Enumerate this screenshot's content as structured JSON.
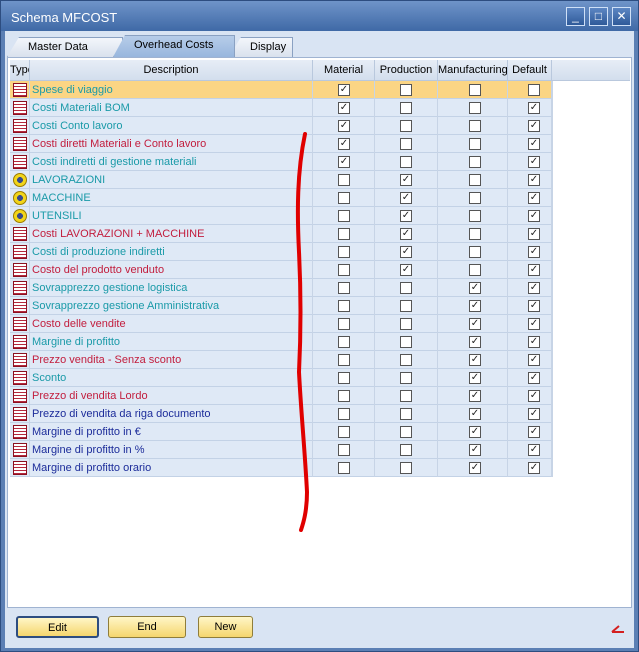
{
  "window": {
    "title": "Schema MFCOST"
  },
  "tabs": [
    {
      "label": "Master Data"
    },
    {
      "label": "Overhead Costs"
    },
    {
      "label": "Display"
    }
  ],
  "columns": {
    "type": "Type",
    "description": "Description",
    "material": "Material",
    "production": "Production",
    "manufacturing": "Manufacturing",
    "default": "Default"
  },
  "rows": [
    {
      "icon": "table-icon",
      "desc": "Spese di viaggio",
      "color": "teal",
      "material": true,
      "production": false,
      "manufacturing": false,
      "default": false,
      "selected": true
    },
    {
      "icon": "table-icon",
      "desc": "Costi Materiali BOM",
      "color": "teal",
      "material": true,
      "production": false,
      "manufacturing": false,
      "default": true
    },
    {
      "icon": "table-icon",
      "desc": "Costi Conto lavoro",
      "color": "teal",
      "material": true,
      "production": false,
      "manufacturing": false,
      "default": true
    },
    {
      "icon": "table-icon",
      "desc": "Costi diretti Materiali e Conto lavoro",
      "color": "red",
      "material": true,
      "production": false,
      "manufacturing": false,
      "default": true
    },
    {
      "icon": "table-icon",
      "desc": "Costi indiretti di gestione materiali",
      "color": "teal",
      "material": true,
      "production": false,
      "manufacturing": false,
      "default": true
    },
    {
      "icon": "gear-icon",
      "desc": "LAVORAZIONI",
      "color": "teal",
      "material": false,
      "production": true,
      "manufacturing": false,
      "default": true
    },
    {
      "icon": "gear-icon",
      "desc": "MACCHINE",
      "color": "teal",
      "material": false,
      "production": true,
      "manufacturing": false,
      "default": true
    },
    {
      "icon": "gear-icon",
      "desc": "UTENSILI",
      "color": "teal",
      "material": false,
      "production": true,
      "manufacturing": false,
      "default": true
    },
    {
      "icon": "table-icon",
      "desc": "Costi LAVORAZIONI + MACCHINE",
      "color": "red",
      "material": false,
      "production": true,
      "manufacturing": false,
      "default": true
    },
    {
      "icon": "table-icon",
      "desc": "Costi di produzione indiretti",
      "color": "teal",
      "material": false,
      "production": true,
      "manufacturing": false,
      "default": true
    },
    {
      "icon": "table-icon",
      "desc": "Costo del prodotto venduto",
      "color": "red",
      "material": false,
      "production": true,
      "manufacturing": false,
      "default": true
    },
    {
      "icon": "table-icon",
      "desc": "Sovrapprezzo gestione logistica",
      "color": "teal",
      "material": false,
      "production": false,
      "manufacturing": true,
      "default": true
    },
    {
      "icon": "table-icon",
      "desc": "Sovrapprezzo gestione Amministrativa",
      "color": "teal",
      "material": false,
      "production": false,
      "manufacturing": true,
      "default": true
    },
    {
      "icon": "table-icon",
      "desc": "Costo delle vendite",
      "color": "red",
      "material": false,
      "production": false,
      "manufacturing": true,
      "default": true
    },
    {
      "icon": "table-icon",
      "desc": "Margine di profitto",
      "color": "teal",
      "material": false,
      "production": false,
      "manufacturing": true,
      "default": true
    },
    {
      "icon": "table-icon",
      "desc": "Prezzo vendita - Senza sconto",
      "color": "red",
      "material": false,
      "production": false,
      "manufacturing": true,
      "default": true
    },
    {
      "icon": "table-icon",
      "desc": "Sconto",
      "color": "teal",
      "material": false,
      "production": false,
      "manufacturing": true,
      "default": true
    },
    {
      "icon": "table-icon",
      "desc": "Prezzo di vendita Lordo",
      "color": "red",
      "material": false,
      "production": false,
      "manufacturing": true,
      "default": true
    },
    {
      "icon": "table-icon",
      "desc": "Prezzo di vendita da riga documento",
      "color": "blue",
      "material": false,
      "production": false,
      "manufacturing": true,
      "default": true
    },
    {
      "icon": "table-icon",
      "desc": "Margine di profitto in €",
      "color": "blue",
      "material": false,
      "production": false,
      "manufacturing": true,
      "default": true
    },
    {
      "icon": "table-icon",
      "desc": "Margine di profitto in %",
      "color": "blue",
      "material": false,
      "production": false,
      "manufacturing": true,
      "default": true
    },
    {
      "icon": "table-icon",
      "desc": "Margine di profitto orario",
      "color": "blue",
      "material": false,
      "production": false,
      "manufacturing": true,
      "default": true
    }
  ],
  "buttons": {
    "edit": "Edit",
    "end": "End",
    "new": "New"
  },
  "colors": {
    "selected_row": "#fbd584",
    "accent": "#5b7fb4",
    "annotation_stroke": "#e00000"
  }
}
